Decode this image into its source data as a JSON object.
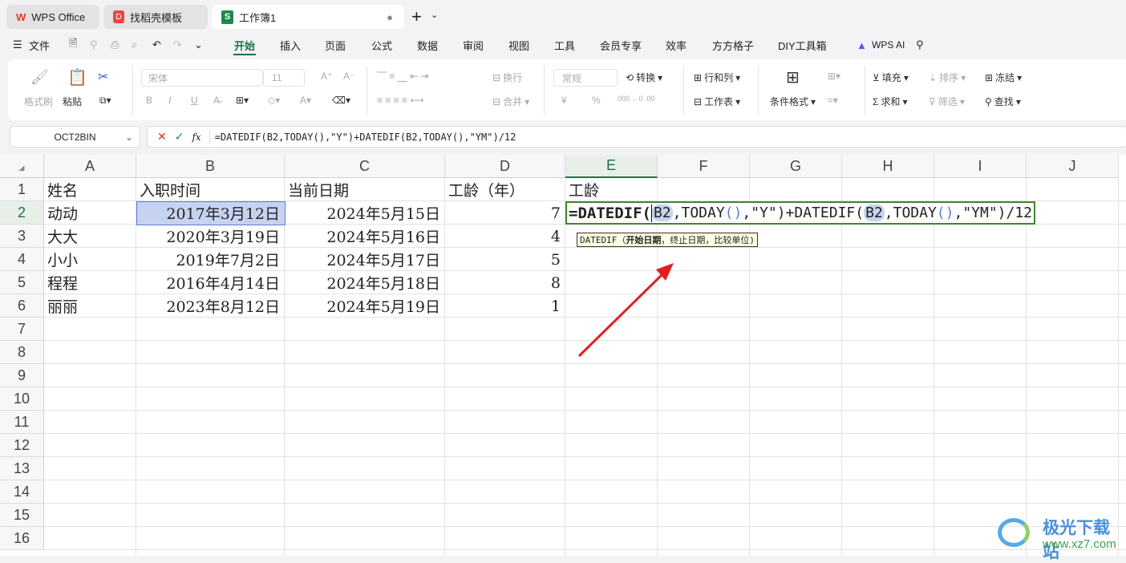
{
  "tabs": [
    {
      "label": "WPS Office"
    },
    {
      "label": "找稻壳模板"
    },
    {
      "label": "工作簿1"
    }
  ],
  "menu": {
    "file": "文件",
    "tabs": [
      "开始",
      "插入",
      "页面",
      "公式",
      "数据",
      "审阅",
      "视图",
      "工具",
      "会员专享",
      "效率",
      "方方格子",
      "DIY工具箱"
    ],
    "ai": "WPS AI"
  },
  "ribbon": {
    "format_painter": "格式刷",
    "paste": "粘贴",
    "font": "宋体",
    "size": "11",
    "wrap": "换行",
    "merge": "合并",
    "number_format": "常规",
    "convert": "转换",
    "rowcol": "行和列",
    "sheet": "工作表",
    "cond_format": "条件格式",
    "fill": "填充",
    "sort": "排序",
    "freeze": "冻结",
    "sum": "求和",
    "filter": "筛选",
    "find": "查找",
    "bold": "B",
    "italic": "I",
    "underline": "U",
    "currency": "¥",
    "percent": "%"
  },
  "formula_bar": {
    "name_box": "OCT2BIN",
    "fx": "fx",
    "formula": "=DATEDIF(B2,TODAY(),\"Y\")+DATEDIF(B2,TODAY(),\"YM\")/12"
  },
  "columns": [
    "A",
    "B",
    "C",
    "D",
    "E",
    "F",
    "G",
    "H",
    "I",
    "J"
  ],
  "rows": [
    "1",
    "2",
    "3",
    "4",
    "5",
    "6",
    "7",
    "8",
    "9",
    "10",
    "11",
    "12",
    "13",
    "14",
    "15",
    "16"
  ],
  "headers": [
    "姓名",
    "入职时间",
    "当前日期",
    "工龄（年）",
    "工龄"
  ],
  "data": [
    [
      "动动",
      "2017年3月12日",
      "2024年5月15日",
      "7"
    ],
    [
      "大大",
      "2020年3月19日",
      "2024年5月16日",
      "4"
    ],
    [
      "小小",
      "2019年7月2日",
      "2024年5月17日",
      "5"
    ],
    [
      "程程",
      "2016年4月14日",
      "2024年5月18日",
      "8"
    ],
    [
      "丽丽",
      "2023年8月12日",
      "2024年5月19日",
      "1"
    ]
  ],
  "edit": {
    "p1": "=DATEDIF(",
    "ref1": "B2",
    "p2": ",TODAY",
    "par1": "()",
    "p3": ",\"Y\")+DATEDIF(",
    "ref2": "B2",
    "p4": ",TODAY",
    "par2": "()",
    "p5": ",\"YM\")/12"
  },
  "tooltip": {
    "fn": "DATEDIF（",
    "arg1": "开始日期",
    "rest": "，终止日期，比较单位)"
  },
  "watermark": {
    "name": "极光下载站",
    "url": "www.xz7.com"
  },
  "colors": {
    "accent": "#1e7145",
    "arrow": "#e02020",
    "ref": "#c5d3f0"
  }
}
